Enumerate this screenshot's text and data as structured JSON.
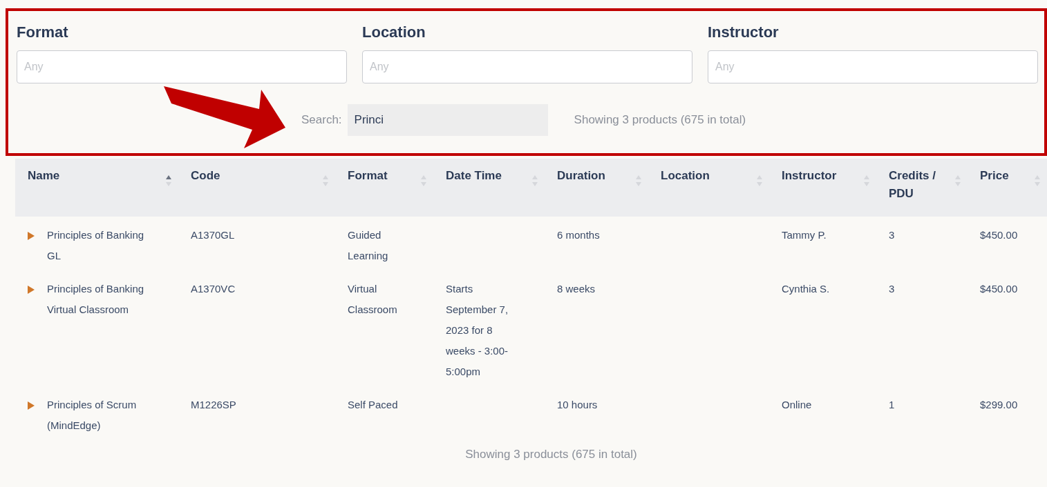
{
  "filters": [
    {
      "label": "Format",
      "placeholder": "Any"
    },
    {
      "label": "Location",
      "placeholder": "Any"
    },
    {
      "label": "Instructor",
      "placeholder": "Any"
    }
  ],
  "search": {
    "label": "Search:",
    "value": "Princi"
  },
  "summary_top": "Showing 3 products (675 in total)",
  "table": {
    "columns": [
      {
        "label": "Name",
        "sorted": true
      },
      {
        "label": "Code",
        "sorted": false
      },
      {
        "label": "Format",
        "sorted": false
      },
      {
        "label": "Date Time",
        "sorted": false
      },
      {
        "label": "Duration",
        "sorted": false
      },
      {
        "label": "Location",
        "sorted": false
      },
      {
        "label": "Instructor",
        "sorted": false
      },
      {
        "label": "Credits / PDU",
        "sorted": false
      },
      {
        "label": "Price",
        "sorted": false
      }
    ],
    "rows": [
      {
        "expanded": false,
        "cells": [
          "Principles of Banking GL",
          "A1370GL",
          "Guided Learning",
          "",
          "6 months",
          "",
          "Tammy P.",
          "3",
          "$450.00"
        ]
      },
      {
        "expanded": false,
        "cells": [
          "Principles of Banking Virtual Classroom",
          "A1370VC",
          "Virtual Classroom",
          "Starts September 7, 2023 for 8 weeks - 3:00-5:00pm",
          "8 weeks",
          "",
          "Cynthia S.",
          "3",
          "$450.00"
        ]
      },
      {
        "expanded": false,
        "cells": [
          "Principles of Scrum (MindEdge)",
          "M1226SP",
          "Self Paced",
          "",
          "10 hours",
          "",
          "Online",
          "1",
          "$299.00"
        ]
      }
    ]
  },
  "summary_bottom": "Showing 3 products (675 in total)"
}
